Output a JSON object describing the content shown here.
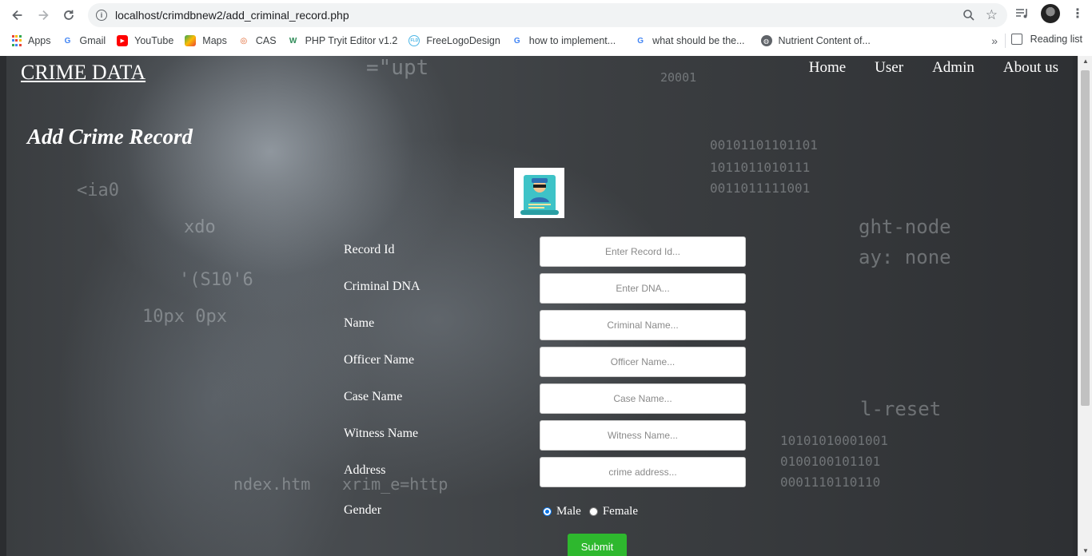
{
  "browser": {
    "url": "localhost/crimdbnew2/add_criminal_record.php",
    "bookmarks": [
      {
        "label": "Apps",
        "icon": "apps-grid-icon"
      },
      {
        "label": "Gmail",
        "icon": "google-icon"
      },
      {
        "label": "YouTube",
        "icon": "youtube-icon"
      },
      {
        "label": "Maps",
        "icon": "maps-icon"
      },
      {
        "label": "CAS",
        "icon": "cas-icon"
      },
      {
        "label": "PHP Tryit Editor v1.2",
        "icon": "w3-icon"
      },
      {
        "label": "FreeLogoDesign",
        "icon": "freelogodesign-icon"
      },
      {
        "label": "how to implement...",
        "icon": "google-icon"
      },
      {
        "label": "what should be the...",
        "icon": "google-icon"
      },
      {
        "label": "Nutrient Content of...",
        "icon": "globe-icon"
      }
    ],
    "more": "»",
    "reading_list": "Reading list"
  },
  "site": {
    "brand": "CRIME DATA",
    "nav": [
      "Home",
      "User",
      "Admin",
      "About us"
    ]
  },
  "page": {
    "title": "Add Crime Record",
    "logo_icon": "criminal-record-icon"
  },
  "form": {
    "fields": [
      {
        "label": "Record Id",
        "placeholder": "Enter Record Id..."
      },
      {
        "label": "Criminal DNA",
        "placeholder": "Enter DNA..."
      },
      {
        "label": "Name",
        "placeholder": "Criminal Name..."
      },
      {
        "label": "Officer Name",
        "placeholder": "Officer Name..."
      },
      {
        "label": "Case Name",
        "placeholder": "Case Name..."
      },
      {
        "label": "Witness Name",
        "placeholder": "Witness Name..."
      },
      {
        "label": "Address",
        "placeholder": "crime address..."
      }
    ],
    "gender_label": "Gender",
    "gender_options": [
      "Male",
      "Female"
    ],
    "gender_selected": "Male",
    "submit_label": "Submit"
  },
  "colors": {
    "submit_green": "#2eb82e",
    "radio_blue": "#0b74e5"
  },
  "background_text": [
    "=\"upt",
    "20001",
    "<ia0",
    "xdo",
    "'(S10'6",
    "10px 0px",
    "ght-node",
    "ay: none",
    "l-reset",
    "ndex.htm",
    "xrim_e=http",
    "00101101101101",
    "1011011010111",
    "0011011111001",
    "10101010001001",
    "0100100101101",
    "0001110110110"
  ]
}
